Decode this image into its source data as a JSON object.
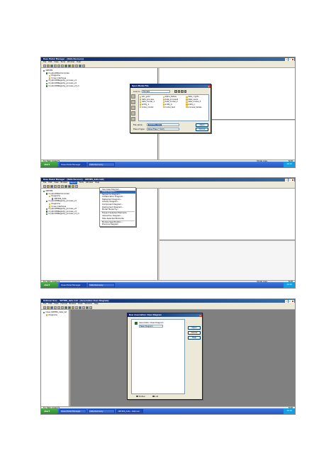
{
  "shot1": {
    "title": "Rose Model Manager - [Data Recovery]",
    "menu": [
      "File",
      "Edit",
      "View",
      "Tools",
      "Window",
      "Help"
    ],
    "tree": [
      {
        "label": "ORTIMS",
        "indent": 0,
        "icon": "db"
      },
      {
        "label": "Crypto/DBAdmin/index",
        "indent": 1,
        "icon": "db"
      },
      {
        "label": "Diagrams",
        "indent": 2,
        "icon": "folder"
      },
      {
        "label": "Cross Interfaces",
        "indent": 2,
        "icon": "folder"
      },
      {
        "label": "Crypto/DBRegistry_process_v1",
        "indent": 1,
        "icon": "db"
      },
      {
        "label": "Crypto/DBRegistry_process_v2",
        "indent": 1,
        "icon": "db"
      },
      {
        "label": "Crypto/DBRegistry_process_v3_m",
        "indent": 1,
        "icon": "db"
      }
    ],
    "dialog": {
      "title": "Open Model File",
      "look_in_label": "Look in:",
      "look_in_value": "Models",
      "files": [
        "ado_pobi",
        "alpha_tables",
        "data_crypto",
        "data_process",
        "data_process2",
        "data_users",
        "data_model_1",
        "data_model_2",
        "data_model_3",
        "entity_a",
        "entity_b",
        "entity_c",
        "index_model",
        "model_test",
        "process_tables"
      ],
      "filename_label": "File name:",
      "filename_value": "ORTIMS_data",
      "filetype_label": "Files of type:",
      "filetype_value": "Rose Files (*.mdl)",
      "open_label": "Open",
      "cancel_label": "Cancel"
    },
    "status_left": "For Help, press F1",
    "status_mid": "Model Area",
    "status_right": "NUM",
    "taskbar": {
      "start": "start",
      "tasks": [
        "Rose Model Manager",
        "Data Recovery"
      ],
      "clock": "10:15"
    }
  },
  "shot2": {
    "title": "Rose Model Manager - [Data Recovery - ORTIMS_data.mdl]",
    "menu": [
      "File",
      "Edit",
      "View",
      "Browse",
      "Report",
      "Tools",
      "Window",
      "Help"
    ],
    "active_menu_index": 4,
    "tree": [
      {
        "label": "ORTIMS",
        "indent": 0,
        "icon": "db"
      },
      {
        "label": "Crypto/DBAdmin/index",
        "indent": 1,
        "icon": "db"
      },
      {
        "label": "Diagrams",
        "indent": 2,
        "icon": "folder"
      },
      {
        "label": "ORTIMS_data",
        "indent": 3,
        "icon": "pkg"
      },
      {
        "label": "Crypto/DBRegistry_process_v1",
        "indent": 1,
        "icon": "db"
      },
      {
        "label": "Diagrams",
        "indent": 2,
        "icon": "folder"
      },
      {
        "label": "Cross Interfaces",
        "indent": 2,
        "icon": "folder"
      },
      {
        "label": "Crypto/DBRegistry_process_v2",
        "indent": 1,
        "icon": "db"
      },
      {
        "label": "Crypto/DBRegistry_process_v3",
        "indent": 1,
        "icon": "db"
      },
      {
        "label": "Crypto/DBRegistry_process_v3_m",
        "indent": 1,
        "icon": "db"
      }
    ],
    "dropdown": [
      "Use Case Diagram...",
      "Class Diagram...",
      "Sequence Diagram...",
      "Collaboration Diagram...",
      "Statechart Diagram...",
      "Activity Diagram...",
      "Component Diagram...",
      "Deployment Diagram...",
      "Model Hierarchy...",
      "Expand Selected Elements",
      "Interaction Diagram...",
      "Hide Selected Elements",
      "Module Specification...",
      "Previous Diagram"
    ],
    "dropdown_highlight": 1,
    "status_left": "For Help, press F1",
    "status_mid": "Model Area",
    "status_right": "NUM",
    "taskbar": {
      "start": "start",
      "tasks": [
        "Rose Model Manager",
        "Data Recovery"
      ],
      "clock": "10:16"
    }
  },
  "shot3": {
    "title": "Rational Rose - ORTIMS_data.mdl - [Association Class Diagram]",
    "menu": [
      "File",
      "Edit",
      "View",
      "Format",
      "Browse",
      "Tools",
      "Window",
      "Help"
    ],
    "tree": [
      {
        "label": "Class ORTIMS_data_list",
        "indent": 0,
        "icon": "db"
      },
      {
        "label": "Diagrams",
        "indent": 1,
        "icon": "folder"
      }
    ],
    "dialog": {
      "title": "New Association Class Diagram",
      "heading": "Association Class Diagram",
      "input_value": "New Diagram",
      "open_label": "Open",
      "cancel_label": "Cancel",
      "help_label": "Help",
      "radio_on": "Toolbar",
      "radio_off": "List"
    },
    "status_left": "For Help, press F1",
    "status_right": "NUM",
    "taskbar": {
      "start": "start",
      "tasks": [
        "Rose Model Manager",
        "Data Recovery",
        "ORTIMS_data - Rational"
      ],
      "clock": "10:18"
    }
  }
}
